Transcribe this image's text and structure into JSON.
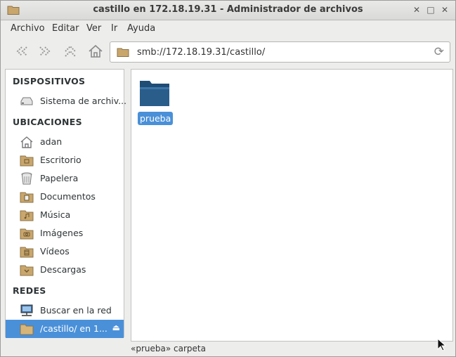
{
  "window": {
    "title": "castillo en 172.18.19.31 - Administrador de archivos",
    "controls": {
      "minimize": "✕",
      "maximize": "□",
      "close": "✕"
    }
  },
  "menubar": [
    "Archivo",
    "Editar",
    "Ver",
    "Ir",
    "Ayuda"
  ],
  "toolbar": {
    "address": "smb://172.18.19.31/castillo/",
    "buttons": [
      "back-icon",
      "forward-icon",
      "up-icon",
      "home-icon"
    ]
  },
  "sidebar": {
    "sections": [
      {
        "header": "DISPOSITIVOS",
        "items": [
          {
            "label": "Sistema de archiv...",
            "icon": "drive-icon"
          }
        ]
      },
      {
        "header": "UBICACIONES",
        "items": [
          {
            "label": "adan",
            "icon": "home-icon"
          },
          {
            "label": "Escritorio",
            "icon": "folder-desktop-icon"
          },
          {
            "label": "Papelera",
            "icon": "trash-icon"
          },
          {
            "label": "Documentos",
            "icon": "folder-documents-icon"
          },
          {
            "label": "Música",
            "icon": "folder-music-icon"
          },
          {
            "label": "Imágenes",
            "icon": "folder-pictures-icon"
          },
          {
            "label": "Vídeos",
            "icon": "folder-videos-icon"
          },
          {
            "label": "Descargas",
            "icon": "folder-downloads-icon"
          }
        ]
      },
      {
        "header": "REDES",
        "items": [
          {
            "label": "Buscar en la red",
            "icon": "network-icon"
          },
          {
            "label": "/castillo/ en 1...",
            "icon": "folder-remote-icon",
            "selected": true
          }
        ]
      }
    ]
  },
  "files": [
    {
      "name": "prueba",
      "type": "folder",
      "selected": true
    }
  ],
  "status": "«prueba» carpeta",
  "colors": {
    "selection": "#4a90d9",
    "folder": "#2a5d8a"
  }
}
